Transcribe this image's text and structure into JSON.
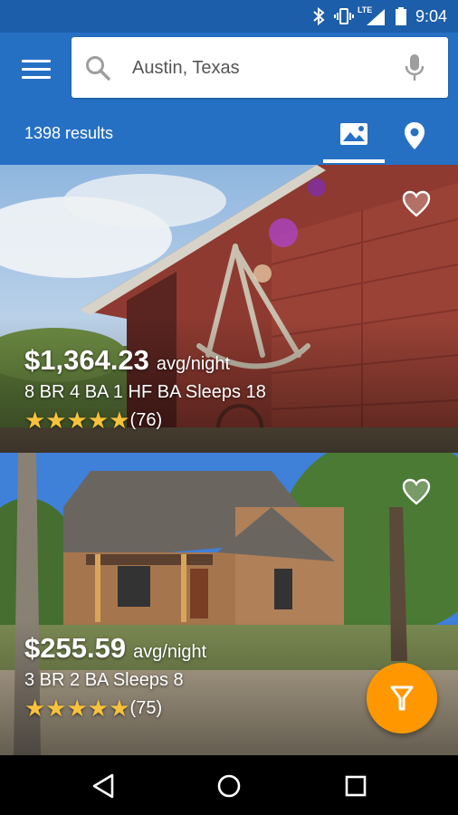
{
  "status_bar": {
    "time": "9:04",
    "network": "LTE",
    "icons": [
      "bluetooth-icon",
      "vibrate-icon",
      "signal-icon",
      "battery-icon"
    ]
  },
  "search": {
    "value": "Austin, Texas",
    "icons": [
      "menu-icon",
      "search-icon",
      "mic-icon"
    ]
  },
  "results_count": "1398 results",
  "tabs": [
    {
      "name": "photos",
      "icon": "image-icon",
      "selected": true
    },
    {
      "name": "map",
      "icon": "location-pin-icon",
      "selected": false
    }
  ],
  "listings": [
    {
      "price": "$1,364.23",
      "unit": "avg/night",
      "description": "8 BR 4 BA 1 HF BA Sleeps 18",
      "stars": "★★★★★",
      "reviews": "(76)",
      "favorite_icon": "heart-outline-icon"
    },
    {
      "price": "$255.59",
      "unit": "avg/night",
      "description": "3 BR 2 BA Sleeps 8",
      "stars": "★★★★★",
      "reviews": "(75)",
      "favorite_icon": "heart-outline-icon"
    }
  ],
  "fab": {
    "icon": "filter-icon"
  },
  "navigation": [
    "back-icon",
    "home-icon",
    "recents-icon"
  ],
  "colors": {
    "app_bar": "#2670c4",
    "status_bar": "#1c5eaa",
    "fab": "#ff9800",
    "stars": "#f9c23c"
  }
}
